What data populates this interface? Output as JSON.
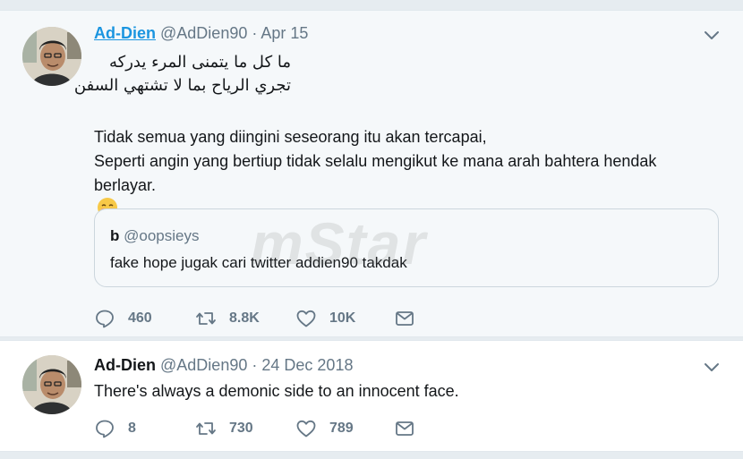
{
  "tweets": [
    {
      "name": "Ad-Dien",
      "handle": "@AdDien90",
      "separator": "·",
      "date": "Apr 15",
      "arabic_lines": [
        "ما كل ما يتمنى المرء يدركه",
        "تجري الرياح بما لا تشتهي السفن"
      ],
      "malay_lines": [
        "Tidak semua yang diingini seseorang itu akan tercapai,",
        "Seperti angin yang bertiup tidak selalu mengikut ke mana arah bahtera hendak",
        "berlayar."
      ],
      "emoji": "smiling-face-emoji",
      "quote": {
        "name": "b",
        "handle": "@oopsieys",
        "text": "fake hope jugak cari twitter addien90 takdak"
      },
      "counts": {
        "replies": "460",
        "retweets": "8.8K",
        "likes": "10K"
      }
    },
    {
      "name": "Ad-Dien",
      "handle": "@AdDien90",
      "separator": "·",
      "date": "24 Dec 2018",
      "text": "There's always a demonic side to an innocent face.",
      "counts": {
        "replies": "8",
        "retweets": "730",
        "likes": "789"
      }
    }
  ],
  "watermark": "mStar",
  "icons": {
    "reply": "reply-icon",
    "retweet": "retweet-icon",
    "like": "heart-icon",
    "dm": "envelope-icon",
    "menu": "chevron-down-icon"
  },
  "colors": {
    "link": "#1b95e0",
    "secondary_text": "#657786",
    "border": "#e1e8ed"
  }
}
